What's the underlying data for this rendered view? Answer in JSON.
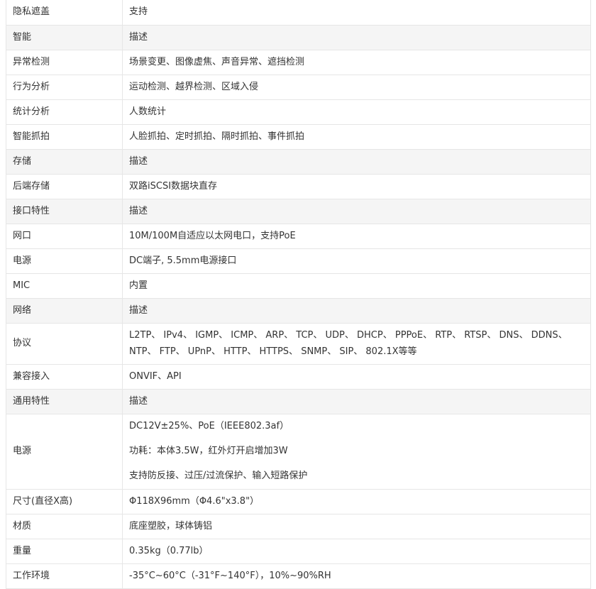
{
  "rows": [
    {
      "label": "隐私遮盖",
      "value": "支持",
      "section": false
    },
    {
      "label": "智能",
      "value": "描述",
      "section": true
    },
    {
      "label": "异常检测",
      "value": "场景变更、图像虚焦、声音异常、遮挡检测",
      "section": false
    },
    {
      "label": "行为分析",
      "value": "运动检测、越界检测、区域入侵",
      "section": false
    },
    {
      "label": "统计分析",
      "value": "人数统计",
      "section": false
    },
    {
      "label": "智能抓拍",
      "value": "人脸抓拍、定时抓拍、隔时抓拍、事件抓拍",
      "section": false
    },
    {
      "label": "存储",
      "value": "描述",
      "section": true
    },
    {
      "label": "后端存储",
      "value": "双路iSCSI数据块直存",
      "section": false
    },
    {
      "label": "接口特性",
      "value": "描述",
      "section": true
    },
    {
      "label": "网口",
      "value": "10M/100M自适应以太网电口，支持PoE",
      "section": false
    },
    {
      "label": "电源",
      "value": "DC端子, 5.5mm电源接口",
      "section": false
    },
    {
      "label": "MIC",
      "value": "内置",
      "section": false
    },
    {
      "label": "网络",
      "value": "描述",
      "section": true
    },
    {
      "label": "协议",
      "value": "L2TP、 IPv4、 IGMP、 ICMP、 ARP、 TCP、 UDP、 DHCP、 PPPoE、 RTP、 RTSP、 DNS、 DDNS、 NTP、 FTP、 UPnP、  HTTP、 HTTPS、 SNMP、 SIP、 802.1X等等",
      "section": false
    },
    {
      "label": "兼容接入",
      "value": "ONVIF、API",
      "section": false
    },
    {
      "label": "通用特性",
      "value": "描述",
      "section": true
    },
    {
      "label": "电源",
      "lines": [
        "DC12V±25%、PoE（IEEE802.3af）",
        "功耗：本体3.5W，红外灯开启增加3W",
        "支持防反接、过压/过流保护、输入短路保护"
      ],
      "section": false
    },
    {
      "label": "尺寸(直径X高)",
      "value": "Φ118X96mm（Φ4.6\"x3.8\"）",
      "section": false
    },
    {
      "label": "材质",
      "value": "底座塑胶，球体铸铝",
      "section": false
    },
    {
      "label": "重量",
      "value": "0.35kg（0.77lb）",
      "section": false
    },
    {
      "label": "工作环境",
      "value": "-35°C~60°C（-31°F~140°F），10%~90%RH",
      "section": false
    }
  ]
}
